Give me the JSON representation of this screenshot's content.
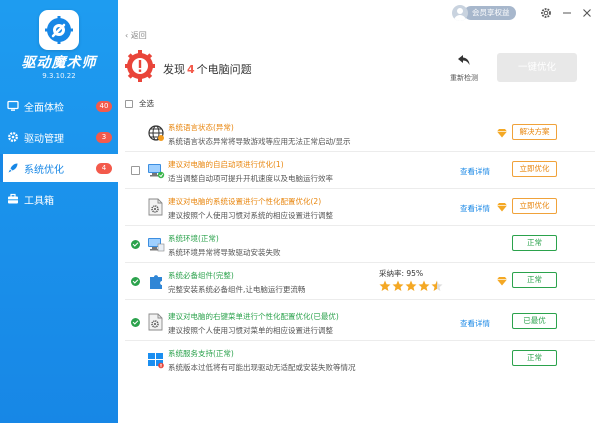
{
  "app": {
    "name": "驱动魔术师",
    "version": "9.3.10.22"
  },
  "sidebar": {
    "items": [
      {
        "label": "全面体检",
        "badge": "40",
        "icon": "monitor-icon"
      },
      {
        "label": "驱动管理",
        "badge": "3",
        "icon": "gear-icon"
      },
      {
        "label": "系统优化",
        "badge": "4",
        "icon": "rocket-icon",
        "active": true
      },
      {
        "label": "工具箱",
        "badge": "",
        "icon": "toolbox-icon"
      }
    ]
  },
  "topbar": {
    "member_label": "会员享权益"
  },
  "back_label": "返回",
  "header": {
    "prefix": "发现",
    "count": "4",
    "suffix": "个电脑问题",
    "rescan_label": "重新检测",
    "optimize_all_label": "一键优化"
  },
  "select_all_label": "全选",
  "rows": [
    {
      "status": "none",
      "icon": "globe-settings-icon",
      "title": "系统语言状态(异常)",
      "title_color": "orange",
      "desc": "系统语言状态异常将导致游戏等应用无法正常启动/显示",
      "detail": "",
      "premium": true,
      "action": "解决方案",
      "action_style": "orange"
    },
    {
      "status": "unchecked",
      "icon": "computer-startup-icon",
      "title": "建议对电脑的自启动项进行优化(1)",
      "title_color": "orange",
      "desc": "适当调整自动项可提升开机速度以及电脑运行效率",
      "detail": "查看详情",
      "premium": false,
      "action": "立即优化",
      "action_style": "orange"
    },
    {
      "status": "none",
      "icon": "settings-document-icon",
      "title": "建议对电脑的系统设置进行个性化配置优化(2)",
      "title_color": "orange",
      "desc": "建议按照个人使用习惯对系统的相应设置进行调整",
      "detail": "查看详情",
      "premium": true,
      "action": "立即优化",
      "action_style": "orange"
    },
    {
      "status": "ok",
      "icon": "computer-environment-icon",
      "title": "系统环境(正常)",
      "title_color": "green",
      "desc": "系统环境异常将导致驱动安装失败",
      "detail": "",
      "premium": false,
      "action": "正常",
      "action_style": "green"
    },
    {
      "status": "ok",
      "icon": "puzzle-component-icon",
      "title": "系统必备组件(完整)",
      "title_color": "green",
      "desc": "完整安装系统必备组件,让电脑运行更流畅",
      "detail": "",
      "rating_label": "采纳率: 95%",
      "rating": 4.5,
      "premium": true,
      "action": "正常",
      "action_style": "green"
    },
    {
      "status": "ok",
      "icon": "settings-document-icon",
      "title": "建议对电脑的右键菜单进行个性化配置优化(已最优)",
      "title_color": "green",
      "desc": "建议按照个人使用习惯对菜单的相应设置进行调整",
      "detail": "查看详情",
      "premium": false,
      "action": "已最优",
      "action_style": "green"
    },
    {
      "status": "none",
      "icon": "windows-service-icon",
      "title": "系统服务支持(正常)",
      "title_color": "green",
      "desc": "系统版本过低将有可能出现驱动无适配或安装失败等情况",
      "detail": "",
      "premium": false,
      "action": "正常",
      "action_style": "green"
    }
  ]
}
